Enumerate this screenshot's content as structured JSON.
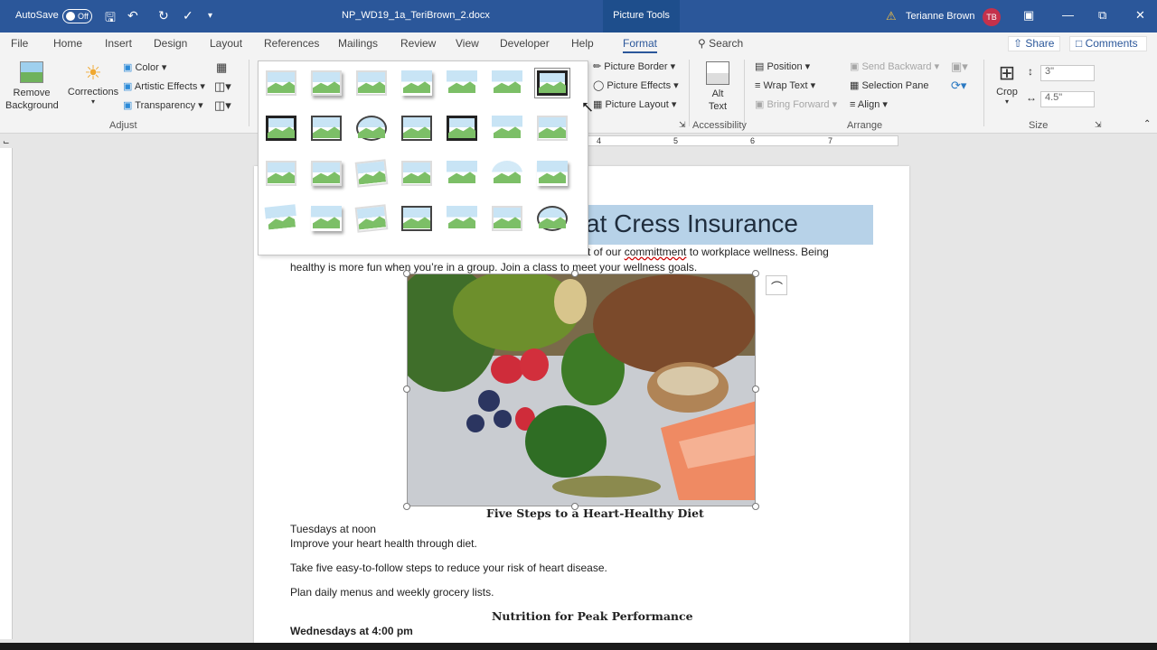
{
  "titlebar": {
    "autosave_label": "AutoSave",
    "autosave_state": "Off",
    "document_title": "NP_WD19_1a_TeriBrown_2.docx",
    "contextual_tab": "Picture Tools",
    "user_name": "Terianne Brown",
    "user_initials": "TB"
  },
  "tabs": [
    "File",
    "Home",
    "Insert",
    "Design",
    "Layout",
    "References",
    "Mailings",
    "Review",
    "View",
    "Developer",
    "Help",
    "Format"
  ],
  "search_label": "Search",
  "share_label": "Share",
  "comments_label": "Comments",
  "ribbon": {
    "adjust": {
      "remove_background": "Remove Background",
      "corrections": "Corrections",
      "color": "Color",
      "artistic_effects": "Artistic Effects",
      "transparency": "Transparency",
      "group_label": "Adjust"
    },
    "picture_styles": {
      "picture_border": "Picture Border",
      "picture_effects": "Picture Effects",
      "picture_layout": "Picture Layout"
    },
    "accessibility": {
      "alt_text": "Alt Text",
      "group_label": "Accessibility"
    },
    "arrange": {
      "position": "Position",
      "wrap_text": "Wrap Text",
      "bring_forward": "Bring Forward",
      "send_backward": "Send Backward",
      "selection_pane": "Selection Pane",
      "align": "Align",
      "group_label": "Arrange"
    },
    "size": {
      "crop": "Crop",
      "height": "3\"",
      "width": "4.5\"",
      "group_label": "Size"
    }
  },
  "ruler_marks": [
    "4",
    "5",
    "6",
    "7"
  ],
  "document": {
    "heading_fragment": "at Cress Insurance",
    "intro_line1_fragment": "t of our",
    "intro_misspelled": "committment",
    "intro_line1_rest": "to workplace wellness. Being",
    "intro_line2": "healthy is more fun when you’re in a group. Join a class to meet your wellness goals.",
    "section1_title": "Five Steps to a Heart-Healthy Diet",
    "section1_lines": [
      "Tuesdays at noon",
      "Improve your heart health through diet.",
      "Take five easy-to-follow steps to reduce your risk of heart disease.",
      "Plan daily menus and weekly grocery lists."
    ],
    "section2_title": "Nutrition for Peak Performance",
    "section2_time": "Wednesdays at 4:00 pm"
  },
  "colors": {
    "title_bar": "#2b579a",
    "heading_band": "#b7d2e8",
    "accent": "#2b579a"
  }
}
